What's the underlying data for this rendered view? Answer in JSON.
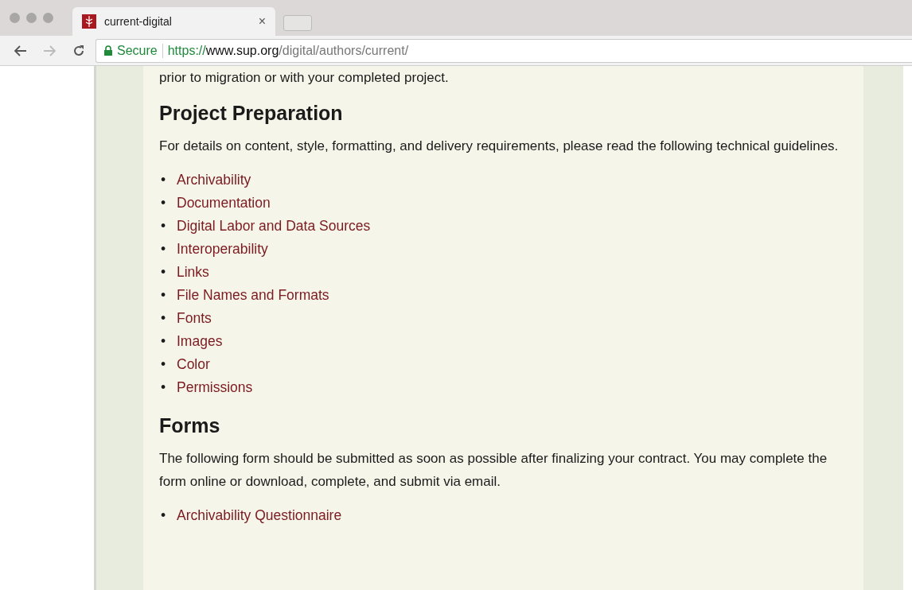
{
  "browser": {
    "tab": {
      "title": "current-digital",
      "close": "×"
    },
    "address": {
      "secure_label": "Secure",
      "scheme": "https://",
      "host": "www.sup.org",
      "path": "/digital/authors/current/"
    }
  },
  "content": {
    "intro_tail": "prior to migration or with your completed project.",
    "sections": [
      {
        "heading": "Project Preparation",
        "text": "For details on content, style, formatting, and delivery requirements, please read the following technical guidelines.",
        "links": [
          {
            "bullet": "•",
            "label": "Archivability"
          },
          {
            "bullet": "•",
            "label": "Documentation"
          },
          {
            "bullet": "•",
            "label": "Digital Labor and Data Sources"
          },
          {
            "bullet": "•",
            "label": "Interoperability"
          },
          {
            "bullet": "•",
            "label": "Links"
          },
          {
            "bullet": "•",
            "label": "File Names and Formats"
          },
          {
            "bullet": "•",
            "label": "Fonts"
          },
          {
            "bullet": "•",
            "label": "Images"
          },
          {
            "bullet": "•",
            "label": "Color"
          },
          {
            "bullet": "•",
            "label": "Permissions"
          }
        ]
      },
      {
        "heading": "Forms",
        "text": "The following form should be submitted as soon as possible after finalizing your contract. You may complete the form online or download, complete, and submit via email.",
        "links": [
          {
            "bullet": "•",
            "label": "Archivability Questionnaire"
          }
        ]
      }
    ]
  }
}
